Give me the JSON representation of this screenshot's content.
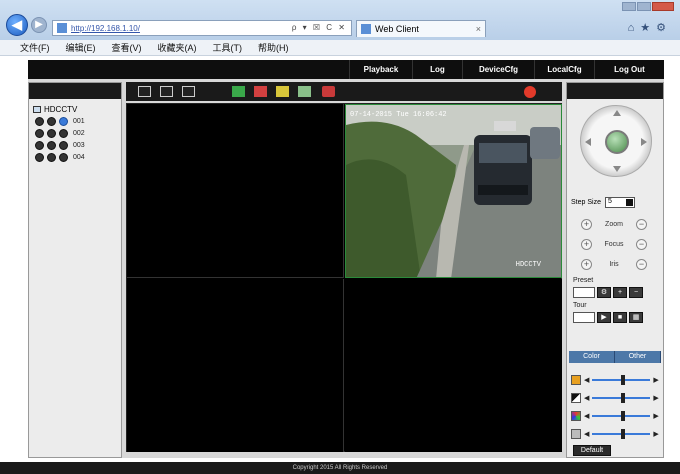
{
  "browser": {
    "url": "http://192.168.1.10/",
    "tab_title": "Web Client",
    "address_icons": "ρ ▾ ☒ C ✕"
  },
  "menubar": [
    "文件(F)",
    "编辑(E)",
    "查看(V)",
    "收藏夹(A)",
    "工具(T)",
    "帮助(H)"
  ],
  "topnav": [
    "Playback",
    "Log",
    "DeviceCfg",
    "LocalCfg",
    "Log Out"
  ],
  "device_tree": {
    "root": "HDCCTV",
    "channels": [
      "001",
      "002",
      "003",
      "004"
    ]
  },
  "toolbar_icons": [
    "1-split-icon",
    "4-split-icon",
    "9-split-icon",
    "open-all-icon",
    "close-all-icon",
    "snapshot-icon",
    "record-icon",
    "talk-icon",
    "alarm-icon"
  ],
  "video": {
    "osd_time": "07-14-2015 Tue 16:06:42",
    "osd_channel": "HDCCTV"
  },
  "ptz": {
    "speed_label": "Step Size",
    "speed_value": "5",
    "zoom_label": "Zoom",
    "focus_label": "Focus",
    "iris_label": "Iris",
    "preset_label": "Preset",
    "tour_label": "Tour"
  },
  "color": {
    "tabs": [
      "Color",
      "Other"
    ],
    "sliders": [
      {
        "name": "brightness",
        "value": 0.5
      },
      {
        "name": "contrast",
        "value": 0.5
      },
      {
        "name": "saturation",
        "value": 0.5
      },
      {
        "name": "hue",
        "value": 0.5
      }
    ],
    "default_label": "Default"
  },
  "footer": "Copyright 2015 All Rights Reserved",
  "colors": {
    "nav_bg": "#0e0e0e",
    "accent": "#3a7ad9",
    "tab_blue": "#4d78a8"
  }
}
